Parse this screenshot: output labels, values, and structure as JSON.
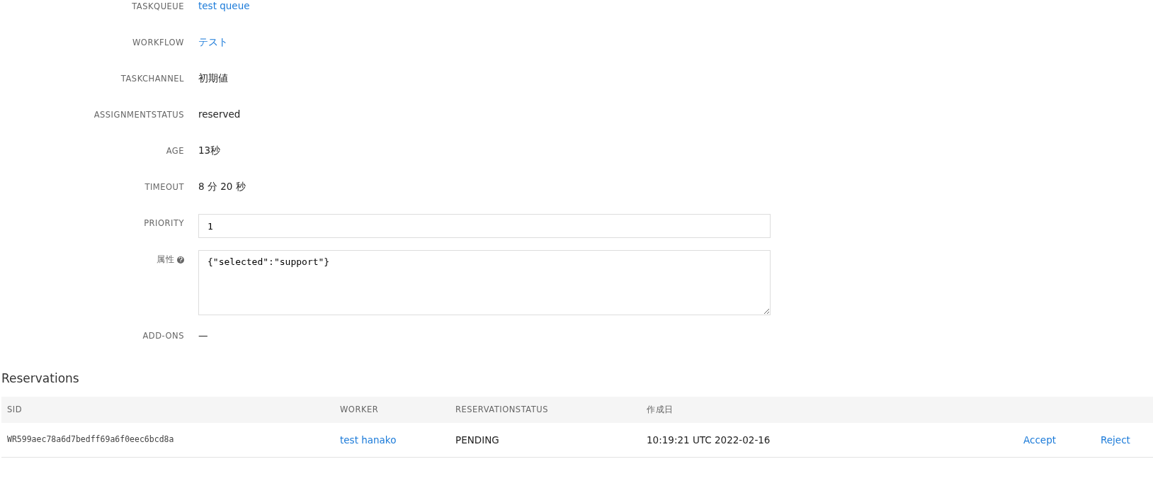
{
  "fields": [
    {
      "label": "TASKQUEUE",
      "kind": "link",
      "value": "test queue"
    },
    {
      "label": "WORKFLOW",
      "kind": "link",
      "value": "テスト"
    },
    {
      "label": "TASKCHANNEL",
      "kind": "text",
      "value": "初期値"
    },
    {
      "label": "ASSIGNMENTSTATUS",
      "kind": "text",
      "value": "reserved"
    },
    {
      "label": "AGE",
      "kind": "text",
      "value": "13秒"
    },
    {
      "label": "TIMEOUT",
      "kind": "text",
      "value": "8 分 20 秒"
    },
    {
      "label": "PRIORITY",
      "kind": "input",
      "value": "1"
    },
    {
      "label": "属性",
      "kind": "textarea",
      "value": "{\"selected\":\"support\"}",
      "help": true
    },
    {
      "label": "ADD-ONS",
      "kind": "text",
      "value": "—"
    }
  ],
  "reservations": {
    "title": "Reservations",
    "columns": [
      "SID",
      "WORKER",
      "RESERVATIONSTATUS",
      "作成日"
    ],
    "rows": [
      {
        "sid": "WR599aec78a6d7bedff69a6f0eec6bcd8a",
        "worker": "test hanako",
        "status": "PENDING",
        "created": "10:19:21 UTC 2022-02-16",
        "actions": [
          "Accept",
          "Reject"
        ]
      }
    ]
  }
}
